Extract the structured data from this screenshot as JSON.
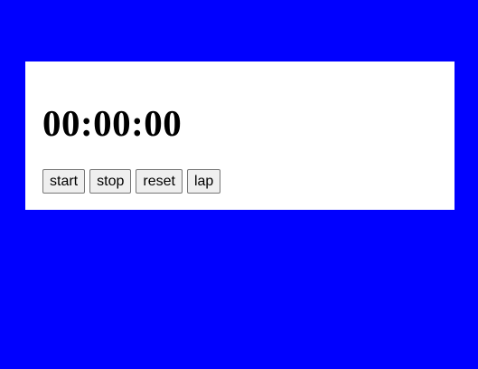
{
  "stopwatch": {
    "display": "00:00:00",
    "buttons": {
      "start": "start",
      "stop": "stop",
      "reset": "reset",
      "lap": "lap"
    }
  },
  "colors": {
    "page_background": "#0000ff",
    "panel_background": "#ffffff",
    "button_background": "#efefef"
  }
}
